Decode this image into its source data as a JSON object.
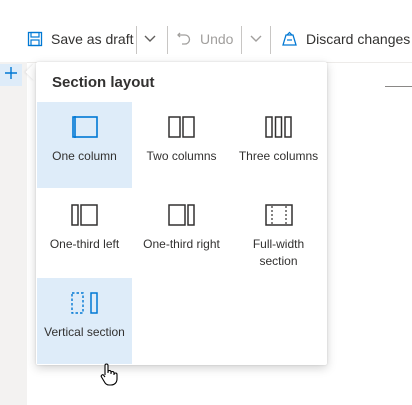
{
  "toolbar": {
    "save_label": "Save as draft",
    "undo_label": "Undo",
    "discard_label": "Discard changes"
  },
  "panel": {
    "title": "Section layout",
    "options": [
      {
        "label": "One column",
        "icon": "one-column-icon",
        "selected": true
      },
      {
        "label": "Two columns",
        "icon": "two-columns-icon",
        "selected": false
      },
      {
        "label": "Three columns",
        "icon": "three-columns-icon",
        "selected": false
      },
      {
        "label": "One-third left",
        "icon": "one-third-left-icon",
        "selected": false
      },
      {
        "label": "One-third right",
        "icon": "one-third-right-icon",
        "selected": false
      },
      {
        "label": "Full-width section",
        "icon": "full-width-section-icon",
        "selected": false
      },
      {
        "label": "Vertical section",
        "icon": "vertical-section-icon",
        "selected": true
      }
    ]
  },
  "colors": {
    "accent": "#0078d4",
    "selected_bg": "#deecf9",
    "disabled_text": "#a19f9d"
  }
}
